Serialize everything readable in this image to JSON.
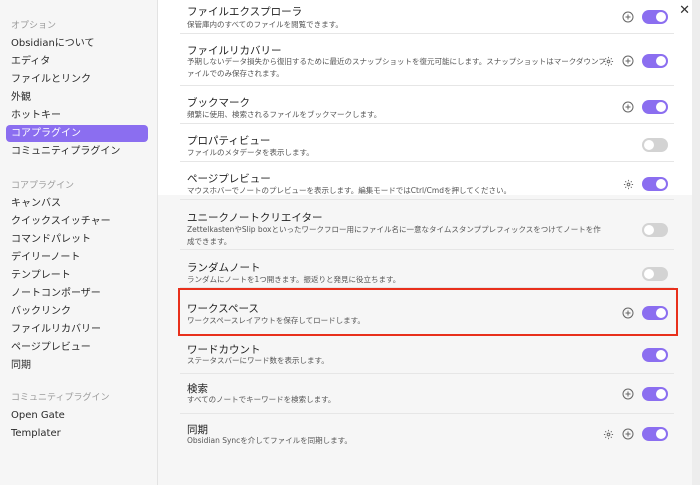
{
  "sidebar": {
    "sections": [
      {
        "title": "オプション",
        "items": [
          "Obsidianについて",
          "エディタ",
          "ファイルとリンク",
          "外観",
          "ホットキー",
          "コアプラグイン",
          "コミュニティプラグイン"
        ]
      },
      {
        "title": "コアプラグイン",
        "items": [
          "キャンバス",
          "クイックスイッチャー",
          "コマンドパレット",
          "デイリーノート",
          "テンプレート",
          "ノートコンポーザー",
          "バックリンク",
          "ファイルリカバリー",
          "ページプレビュー",
          "同期"
        ]
      },
      {
        "title": "コミュニティプラグイン",
        "items": [
          "Open Gate",
          "Templater"
        ]
      }
    ],
    "active_item": "コアプラグイン"
  },
  "window": {
    "close_symbol": "✕"
  },
  "plugins": [
    {
      "title": "ファイルエクスプローラ",
      "desc": "保管庫内のすべてのファイルを閲覧できます。",
      "settings": false,
      "add": true,
      "enabled": true
    },
    {
      "title": "ファイルリカバリー",
      "desc": "予期しないデータ損失から復旧するために最近のスナップショットを復元可能にします。スナップショットはマークダウンファイルでのみ保存されます。",
      "settings": true,
      "add": true,
      "enabled": true
    },
    {
      "title": "ブックマーク",
      "desc": "頻繁に使用、検索されるファイルをブックマークします。",
      "settings": false,
      "add": true,
      "enabled": true
    },
    {
      "title": "プロパティビュー",
      "desc": "ファイルのメタデータを表示します。",
      "settings": false,
      "add": false,
      "enabled": false
    },
    {
      "title": "ページプレビュー",
      "desc": "マウスホバーでノートのプレビューを表示します。編集モードではCtrl/Cmdを押してください。",
      "settings": true,
      "add": false,
      "enabled": true
    },
    {
      "title": "ユニークノートクリエイター",
      "desc": "ZettelkastenやSlip boxといったワークフロー用にファイル名に一意なタイムスタンププレフィックスをつけてノートを作成できます。",
      "settings": false,
      "add": false,
      "enabled": false
    },
    {
      "title": "ランダムノート",
      "desc": "ランダムにノートを1つ開きます。振返りと発見に役立ちます。",
      "settings": false,
      "add": false,
      "enabled": false
    },
    {
      "title": "ワークスペース",
      "desc": "ワークスペースレイアウトを保存してロードします。",
      "settings": false,
      "add": true,
      "enabled": true
    },
    {
      "title": "ワードカウント",
      "desc": "ステータスバーにワード数を表示します。",
      "settings": false,
      "add": false,
      "enabled": true
    },
    {
      "title": "検索",
      "desc": "すべてのノートでキーワードを検索します。",
      "settings": false,
      "add": true,
      "enabled": true
    },
    {
      "title": "同期",
      "desc": "Obsidian Syncを介してファイルを同期します。",
      "settings": true,
      "add": true,
      "enabled": true
    }
  ],
  "colors": {
    "accent": "#8b6ef0",
    "highlight": "#e8301c"
  }
}
